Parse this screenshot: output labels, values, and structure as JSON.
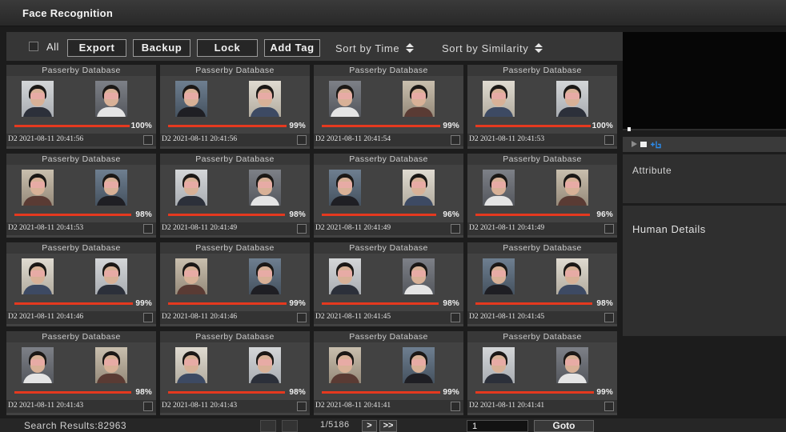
{
  "window": {
    "title": "Face Recognition"
  },
  "toolbar": {
    "select_all": {
      "label": "All",
      "checked": false
    },
    "buttons": [
      {
        "label": "Export"
      },
      {
        "label": "Backup"
      },
      {
        "label": "Lock"
      },
      {
        "label": "Add Tag"
      }
    ],
    "sort": [
      {
        "label": "Sort by Time",
        "icon": "sort-up-down-icon"
      },
      {
        "label": "Sort by Similarity",
        "icon": "sort-up-down-icon"
      }
    ]
  },
  "results": [
    {
      "database": "Passerby Database",
      "similarity": "100%",
      "time": "D2 2021-08-11 20:41:56",
      "checked": false
    },
    {
      "database": "Passerby Database",
      "similarity": "99%",
      "time": "D2 2021-08-11 20:41:56",
      "checked": false
    },
    {
      "database": "Passerby Database",
      "similarity": "99%",
      "time": "D2 2021-08-11 20:41:54",
      "checked": false
    },
    {
      "database": "Passerby Database",
      "similarity": "100%",
      "time": "D2 2021-08-11 20:41:53",
      "checked": false
    },
    {
      "database": "Passerby Database",
      "similarity": "98%",
      "time": "D2 2021-08-11 20:41:53",
      "checked": false
    },
    {
      "database": "Passerby Database",
      "similarity": "98%",
      "time": "D2 2021-08-11 20:41:49",
      "checked": false
    },
    {
      "database": "Passerby Database",
      "similarity": "96%",
      "time": "D2 2021-08-11 20:41:49",
      "checked": false
    },
    {
      "database": "Passerby Database",
      "similarity": "96%",
      "time": "D2 2021-08-11 20:41:49",
      "checked": false
    },
    {
      "database": "Passerby Database",
      "similarity": "99%",
      "time": "D2 2021-08-11 20:41:46",
      "checked": false
    },
    {
      "database": "Passerby Database",
      "similarity": "99%",
      "time": "D2 2021-08-11 20:41:46",
      "checked": false
    },
    {
      "database": "Passerby Database",
      "similarity": "98%",
      "time": "D2 2021-08-11 20:41:45",
      "checked": false
    },
    {
      "database": "Passerby Database",
      "similarity": "98%",
      "time": "D2 2021-08-11 20:41:45",
      "checked": false
    },
    {
      "database": "Passerby Database",
      "similarity": "98%",
      "time": "D2 2021-08-11 20:41:43",
      "checked": false
    },
    {
      "database": "Passerby Database",
      "similarity": "98%",
      "time": "D2 2021-08-11 20:41:43",
      "checked": false
    },
    {
      "database": "Passerby Database",
      "similarity": "99%",
      "time": "D2 2021-08-11 20:41:41",
      "checked": false
    },
    {
      "database": "Passerby Database",
      "similarity": "99%",
      "time": "D2 2021-08-11 20:41:41",
      "checked": false
    }
  ],
  "player": {
    "controls": [
      {
        "icon": "play-icon"
      },
      {
        "icon": "stop-icon"
      },
      {
        "icon": "clip-icon"
      }
    ]
  },
  "details": {
    "attribute_heading": "Attribute",
    "human_details_heading": "Human Details"
  },
  "pagination": {
    "search_results": "Search Results:82963",
    "page": "1/5186",
    "next": ">",
    "last": ">>",
    "goto_value": "1",
    "goto_button": "Goto"
  },
  "colors": {
    "similarity_bar": "#e5391f",
    "clip_icon": "#2c8ae8"
  }
}
